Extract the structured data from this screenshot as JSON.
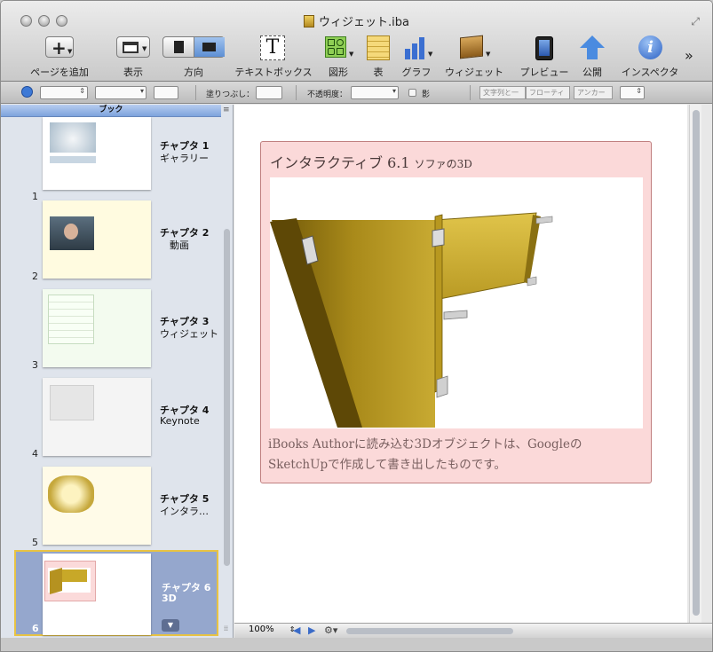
{
  "window": {
    "title": "ウィジェット.iba"
  },
  "toolbar": {
    "items": [
      {
        "label": "ページを追加",
        "icon": "plus-icon"
      },
      {
        "label": "表示",
        "icon": "view-icon"
      },
      {
        "label": "方向",
        "icon": "orientation-icon"
      },
      {
        "label": "テキストボックス",
        "icon": "textbox-icon",
        "glyph": "T"
      },
      {
        "label": "図形",
        "icon": "shapes-icon"
      },
      {
        "label": "表",
        "icon": "table-icon"
      },
      {
        "label": "グラフ",
        "icon": "chart-icon"
      },
      {
        "label": "ウィジェット",
        "icon": "widget-icon"
      },
      {
        "label": "プレビュー",
        "icon": "ipad-icon"
      },
      {
        "label": "公開",
        "icon": "publish-icon"
      },
      {
        "label": "インスペクタ",
        "icon": "inspector-icon",
        "glyph": "i"
      }
    ],
    "overflow": "»"
  },
  "formatbar": {
    "fill_label": "塗りつぶし：",
    "opacity_label": "不透明度：",
    "shadow_label": "影",
    "wrap_label": "文字列と一",
    "float_label": "フローティ",
    "anchor_label": "アンカー"
  },
  "sidebar": {
    "header": "ブック",
    "chapters": [
      {
        "number": "1",
        "title": "チャプタ 1",
        "subtitle": "ギャラリー",
        "selected": false
      },
      {
        "number": "2",
        "title": "チャプタ 2",
        "subtitle": "　動画",
        "selected": false
      },
      {
        "number": "3",
        "title": "チャプタ 3",
        "subtitle": "ウィジェット",
        "selected": false
      },
      {
        "number": "4",
        "title": "チャプタ 4",
        "subtitle": "Keynote",
        "selected": false
      },
      {
        "number": "5",
        "title": "チャプタ 5",
        "subtitle": "インタラ…",
        "selected": false
      },
      {
        "number": "6",
        "title": "チャプタ 6",
        "subtitle": "3D",
        "selected": true
      }
    ]
  },
  "page": {
    "title": "インタラクティブ 6.1",
    "subtitle": "ソファの3D",
    "caption_line1": "iBooks Authorに読み込む3Dオブジェクトは、Googleの",
    "caption_line2": "SketchUpで作成して書き出したものです。"
  },
  "bottombar": {
    "zoom": "100%"
  },
  "colors": {
    "page_background": "#fbd9d9",
    "sidebar_selection": "#95a7cd",
    "selection_border": "#e8c343",
    "sofa": "#c8a828"
  }
}
